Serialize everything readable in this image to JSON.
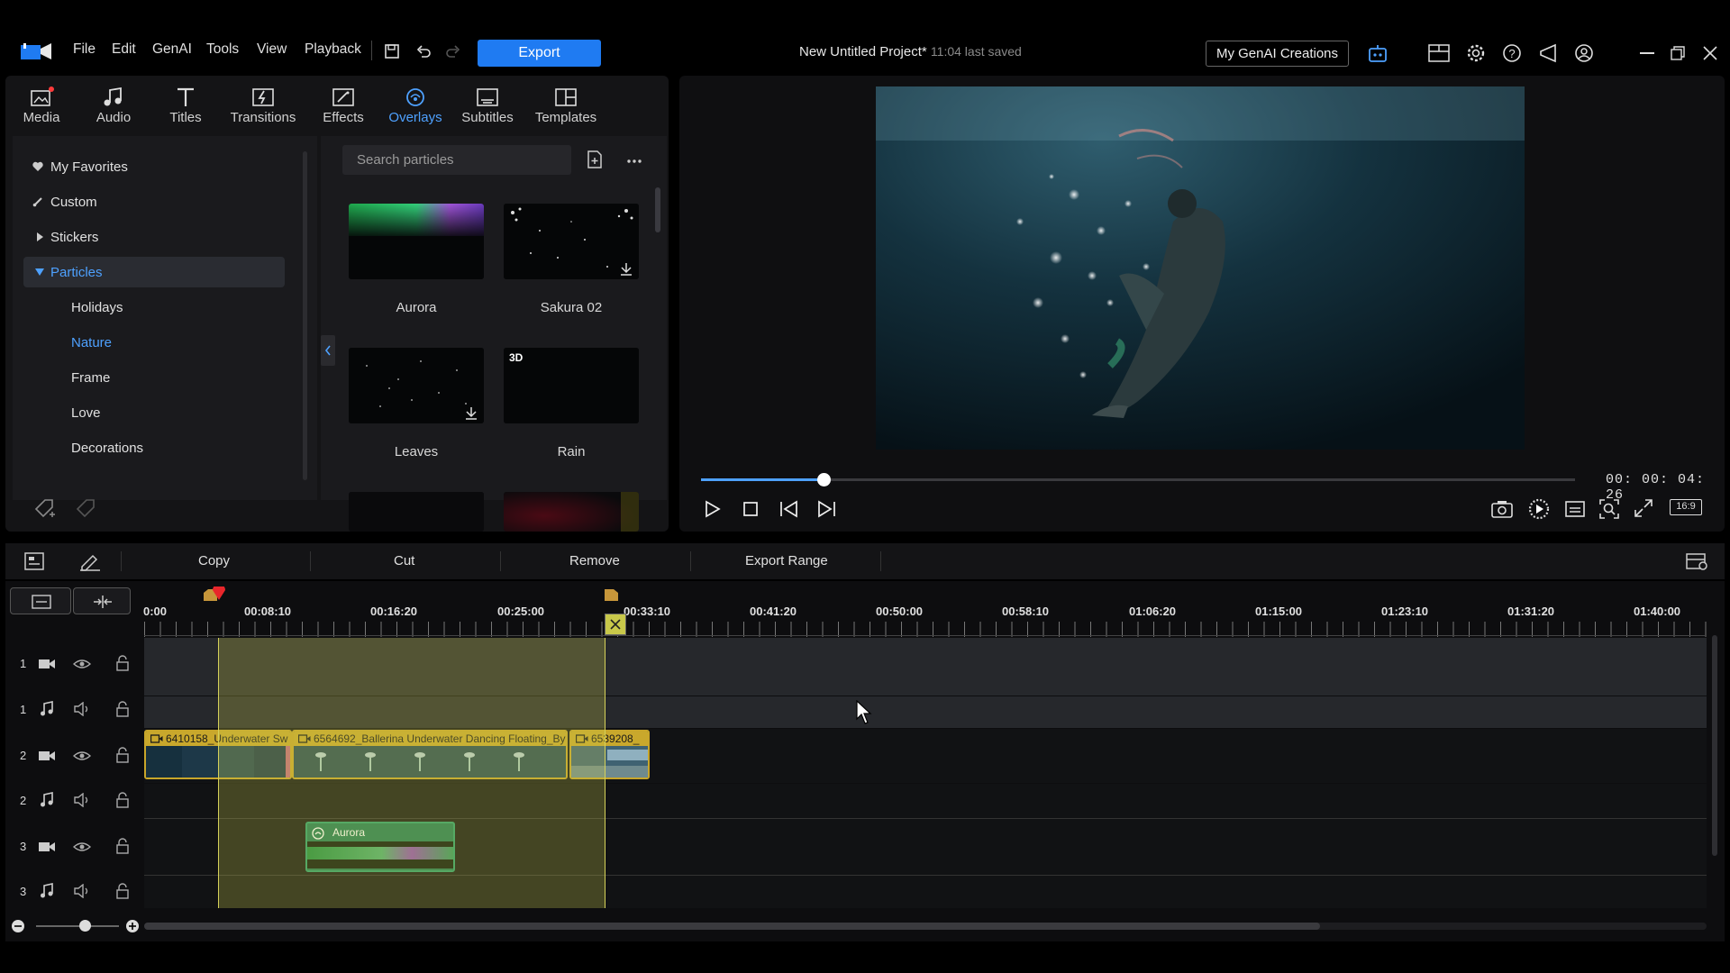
{
  "menubar": {
    "menu": [
      "File",
      "Edit",
      "GenAI",
      "Tools",
      "View",
      "Playback"
    ],
    "export_label": "Export",
    "project_title": "New Untitled Project*",
    "last_saved": "11:04 last saved",
    "genai_creations": "My GenAI Creations"
  },
  "library": {
    "tabs": [
      "Media",
      "Audio",
      "Titles",
      "Transitions",
      "Effects",
      "Overlays",
      "Subtitles",
      "Templates"
    ],
    "active_tab": "Overlays",
    "categories": {
      "favorites": "My Favorites",
      "custom": "Custom",
      "stickers": "Stickers",
      "particles": "Particles",
      "sub": [
        "Holidays",
        "Nature",
        "Frame",
        "Love",
        "Decorations"
      ],
      "active_sub": "Nature"
    },
    "search_placeholder": "Search particles",
    "items": [
      "Aurora",
      "Sakura 02",
      "Leaves",
      "Rain"
    ],
    "rain_badge": "3D"
  },
  "preview": {
    "timecode": "00: 00: 04: 26",
    "aspect": "16:9",
    "progress": 0.14
  },
  "timeline": {
    "toolbar": [
      "Copy",
      "Cut",
      "Remove",
      "Export Range"
    ],
    "ruler": [
      "0:00",
      "00:08:10",
      "00:16:20",
      "00:25:00",
      "00:33:10",
      "00:41:20",
      "00:50:00",
      "00:58:10",
      "01:06:20",
      "01:15:00",
      "01:23:10",
      "01:31:20",
      "01:40:00"
    ],
    "tracks": [
      "1",
      "1",
      "2",
      "2",
      "3",
      "3"
    ],
    "clips": {
      "c1": "6410158_Underwater Sw",
      "c2": "6564692_Ballerina Underwater Dancing Floating_By",
      "c3": "6539208_",
      "overlay": "Aurora"
    }
  },
  "colors": {
    "accent": "#4ea1ff",
    "export": "#1f7bf2",
    "range": "#c8c84a",
    "clip": "#c9a82c",
    "overlay_clip": "#2a9d6e"
  }
}
